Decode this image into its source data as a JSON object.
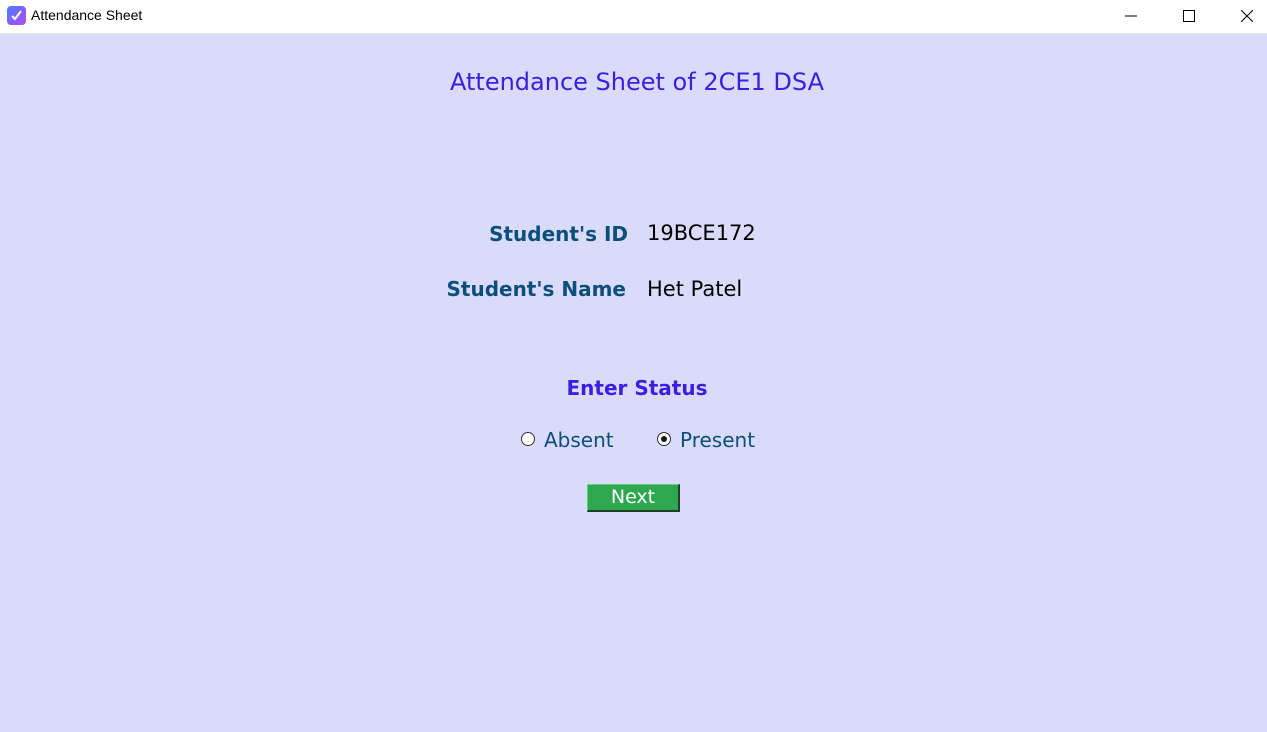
{
  "window": {
    "title": "Attendance Sheet",
    "icon": "checkbox-app-icon",
    "controls": {
      "minimize": "minimize-icon",
      "maximize": "maximize-icon",
      "close": "close-icon"
    }
  },
  "main": {
    "heading": "Attendance Sheet of 2CE1 DSA",
    "student_id_label": "Student's ID",
    "student_id_value": "19BCE172",
    "student_name_label": "Student's Name",
    "student_name_value": "Het Patel",
    "status_title": "Enter Status",
    "status_options": [
      {
        "label": "Absent",
        "selected": false
      },
      {
        "label": "Present",
        "selected": true
      }
    ],
    "next_label": "Next"
  },
  "colors": {
    "background": "#dadafa",
    "heading": "#3d1ee0",
    "label": "#0b4f7a",
    "button": "#2ea84f"
  }
}
